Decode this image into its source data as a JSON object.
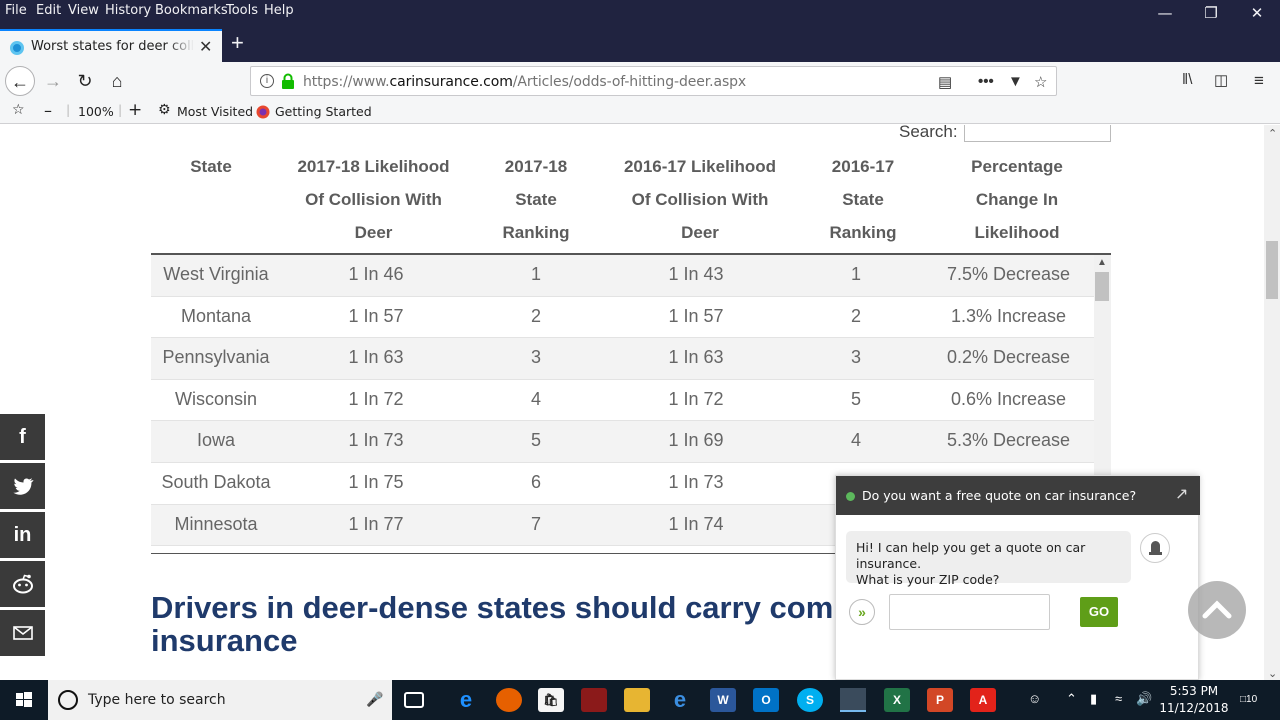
{
  "menubar": {
    "items": [
      "File",
      "Edit",
      "View",
      "History",
      "Bookmarks",
      "Tools",
      "Help"
    ]
  },
  "tab": {
    "title": "Worst states for deer collision - c",
    "close": "✕",
    "new_tab": "+"
  },
  "navbar": {
    "url_prefix": "https://www.",
    "url_domain": "carinsurance.com",
    "url_path": "/Articles/odds-of-hitting-deer.aspx"
  },
  "bookmarks": {
    "zoom": "100%",
    "most_visited": "Most Visited",
    "getting_started": "Getting Started"
  },
  "page": {
    "search_label": "Search:",
    "search_value": "",
    "table": {
      "headers": [
        [
          "State"
        ],
        [
          "2017-18 Likelihood",
          "Of Collision With",
          "Deer"
        ],
        [
          "2017-18",
          "State",
          "Ranking"
        ],
        [
          "2016-17 Likelihood",
          "Of Collision With",
          "Deer"
        ],
        [
          "2016-17",
          "State",
          "Ranking"
        ],
        [
          "Percentage",
          "Change In",
          "Likelihood"
        ]
      ],
      "rows": [
        [
          "West Virginia",
          "1 In 46",
          "1",
          "1 In 43",
          "1",
          "7.5% Decrease"
        ],
        [
          "Montana",
          "1 In 57",
          "2",
          "1 In 57",
          "2",
          "1.3% Increase"
        ],
        [
          "Pennsylvania",
          "1 In 63",
          "3",
          "1 In 63",
          "3",
          "0.2% Decrease"
        ],
        [
          "Wisconsin",
          "1 In 72",
          "4",
          "1 In 72",
          "5",
          "0.6% Increase"
        ],
        [
          "Iowa",
          "1 In 73",
          "5",
          "1 In 69",
          "4",
          "5.3% Decrease"
        ],
        [
          "South Dakota",
          "1 In 75",
          "6",
          "1 In 73",
          "",
          ""
        ],
        [
          "Minnesota",
          "1 In 77",
          "7",
          "1 In 74",
          "",
          ""
        ]
      ]
    },
    "heading_line1": "Drivers in deer-dense states should carry compr",
    "heading_line2": "insurance"
  },
  "social": [
    "f",
    "t",
    "in",
    "r",
    "m"
  ],
  "chat": {
    "header": "Do you want a free quote on car insurance?",
    "message_line1": "Hi! I can help you get a quote on car insurance.",
    "message_line2": "What is your ZIP code?",
    "zip_value": "",
    "go_label": "GO"
  },
  "taskbar": {
    "search_placeholder": "Type here to search",
    "time": "5:53 PM",
    "date": "11/12/2018",
    "notification_count": "10"
  },
  "colors": {
    "titlebar": "#202340",
    "heading": "#1f3a6b",
    "go_button": "#5f9e18",
    "taskbar": "#0e1b27"
  }
}
